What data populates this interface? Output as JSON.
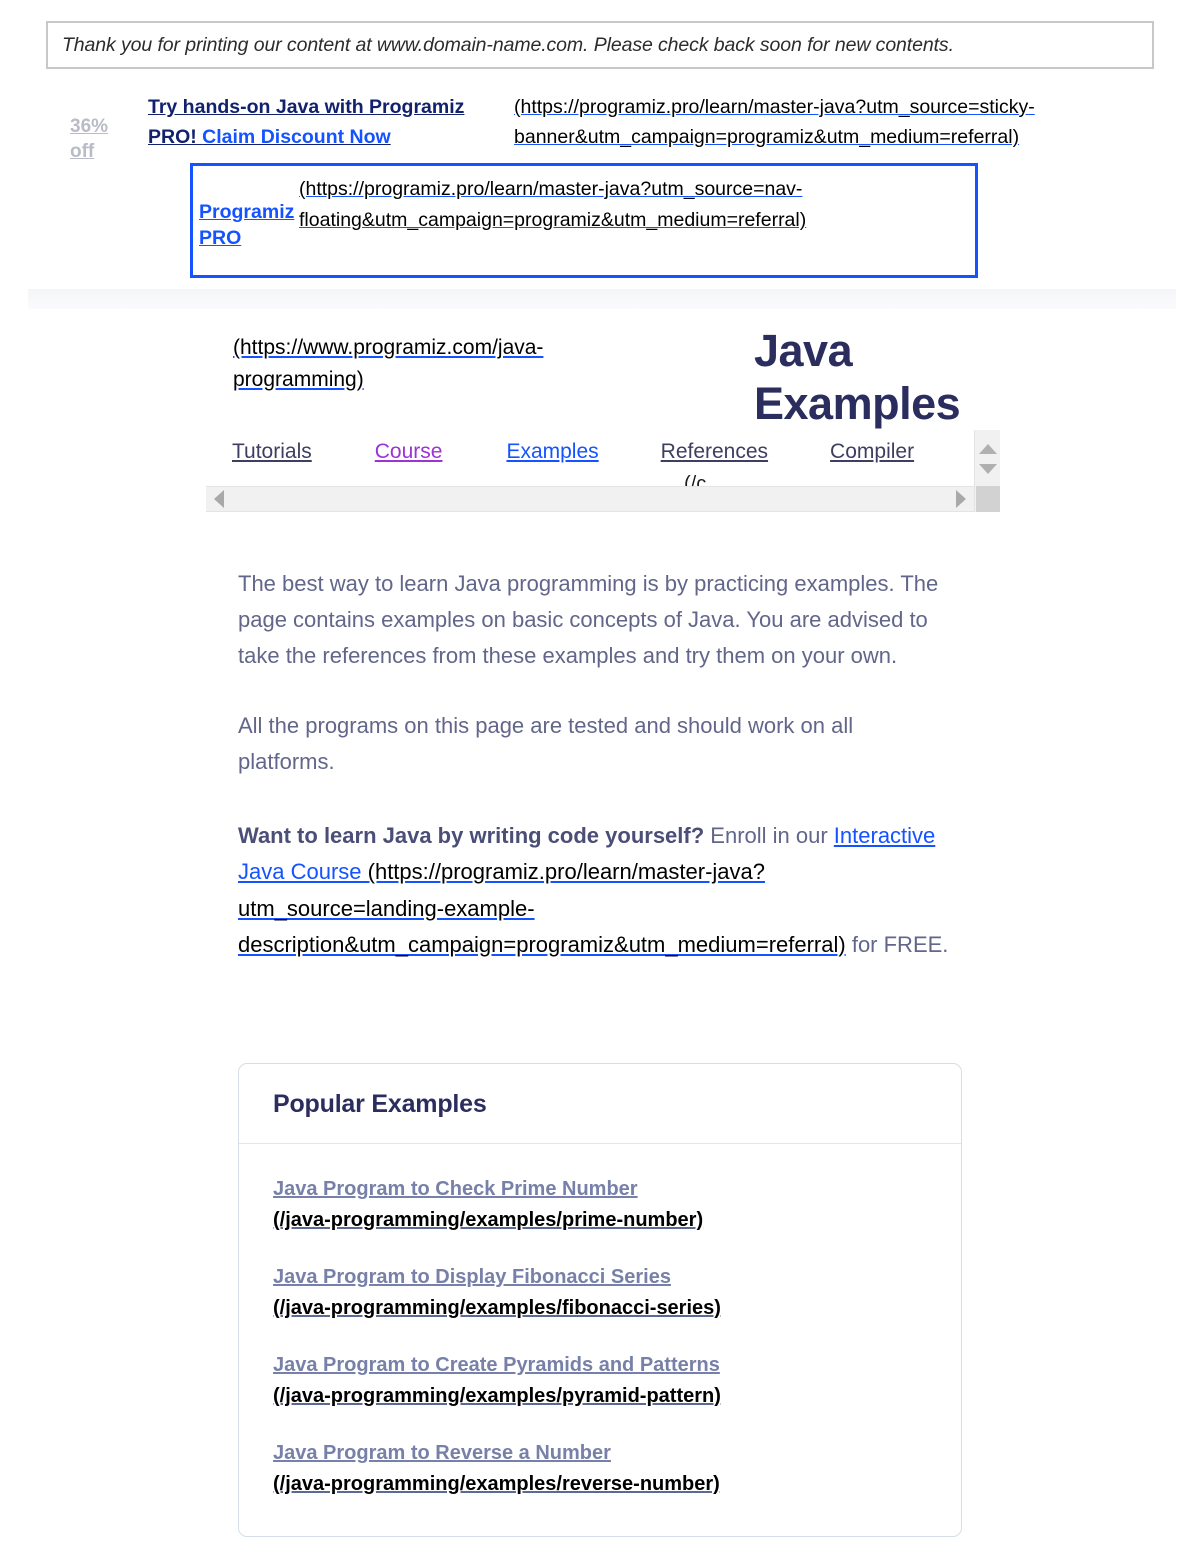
{
  "print_notice": {
    "text": "Thank you for printing our content at www.domain-name.com. Please check back soon for new contents."
  },
  "promo": {
    "badge": "36% off",
    "headline": "Try hands-on Java with Programiz PRO! ",
    "cta": "Claim Discount Now",
    "url": "(https://programiz.pro/learn/master-java?utm_source=sticky-banner&utm_campaign=programiz&utm_medium=referral)"
  },
  "floating_pro": {
    "label": "Programiz PRO",
    "url": "(https://programiz.pro/learn/master-java?utm_source=nav-floating&utm_campaign=programiz&utm_medium=referral)"
  },
  "header": {
    "logo_url": "(https://www.programiz.com/java-programming)",
    "title": "Java Examples"
  },
  "nav": {
    "items": [
      {
        "label": "Tutorials",
        "state": "default"
      },
      {
        "label": "Course",
        "state": "visited"
      },
      {
        "label": "Examples",
        "state": "active"
      },
      {
        "label": "References",
        "state": "default"
      },
      {
        "label": "Compiler",
        "state": "default"
      }
    ],
    "clipped_fragment": "(/c"
  },
  "article": {
    "p1": "The best way to learn Java programming is by practicing examples. The page contains examples on basic concepts of Java. You are advised to take the references from these examples and try them on your own.",
    "p2": "All the programs on this page are tested and should work on all platforms.",
    "p3_bold": "Want to learn Java by writing code yourself?",
    "p3_mid": " Enroll in our ",
    "p3_link": "Interactive Java Course",
    "p3_url": " (https://programiz.pro/learn/master-java?utm_source=landing-example-description&utm_campaign=programiz&utm_medium=referral)",
    "p3_tail": " for FREE."
  },
  "popular_examples": {
    "heading": "Popular Examples",
    "items": [
      {
        "title": "Java Program to Check Prime Number",
        "url": "(/java-programming/examples/prime-number)"
      },
      {
        "title": "Java Program to Display Fibonacci Series",
        "url": "(/java-programming/examples/fibonacci-series)"
      },
      {
        "title": "Java Program to Create Pyramids and Patterns",
        "url": "(/java-programming/examples/pyramid-pattern)"
      },
      {
        "title": "Java Program to Reverse a Number",
        "url": "(/java-programming/examples/reverse-number)"
      }
    ]
  },
  "colors": {
    "link_blue": "#1453ff",
    "visited_purple": "#9b33d6",
    "title_navy": "#2b2d5e",
    "body_slate": "#62668a",
    "badge_gray": "#b9bcc6",
    "card_border": "#d6deeb"
  }
}
